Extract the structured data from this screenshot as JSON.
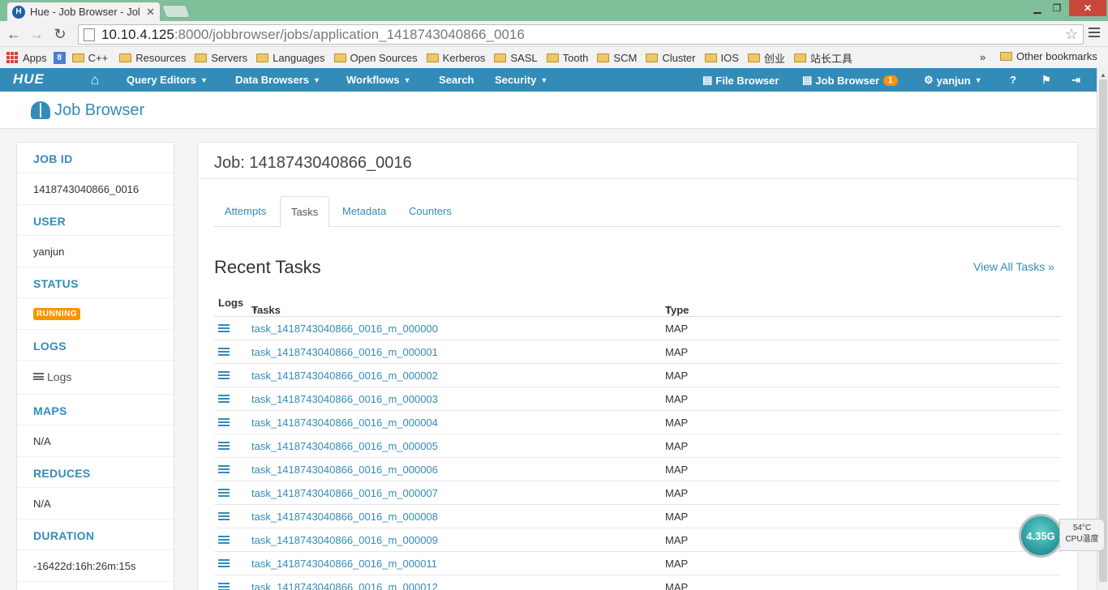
{
  "browser": {
    "tab_title": "Hue - Job Browser - Jol",
    "url_host": "10.10.4.125",
    "url_path": ":8000/jobbrowser/jobs/application_1418743040866_0016"
  },
  "bookmarks": {
    "apps": "Apps",
    "items": [
      "C++",
      "Resources",
      "Servers",
      "Languages",
      "Open Sources",
      "Kerberos",
      "SASL",
      "Tooth",
      "SCM",
      "Cluster",
      "IOS",
      "创业",
      "站长工具"
    ],
    "more": "»",
    "other": "Other bookmarks"
  },
  "nav": {
    "logo": "HUE",
    "query_editors": "Query Editors",
    "data_browsers": "Data Browsers",
    "workflows": "Workflows",
    "search": "Search",
    "security": "Security",
    "file_browser": "File Browser",
    "job_browser": "Job Browser",
    "job_browser_count": "1",
    "user": "yanjun",
    "brand_color": "#338bb8"
  },
  "page": {
    "title": "Job Browser"
  },
  "sidebar": {
    "job_id_label": "JOB ID",
    "job_id": "1418743040866_0016",
    "user_label": "USER",
    "user": "yanjun",
    "status_label": "STATUS",
    "status": "RUNNING",
    "logs_label": "LOGS",
    "logs": "Logs",
    "maps_label": "MAPS",
    "maps": "N/A",
    "reduces_label": "REDUCES",
    "reduces": "N/A",
    "duration_label": "DURATION",
    "duration": "-16422d:16h:26m:15s"
  },
  "main": {
    "job_title": "Job: 1418743040866_0016",
    "tabs": [
      "Attempts",
      "Tasks",
      "Metadata",
      "Counters"
    ],
    "active_tab": "Tasks",
    "section_title": "Recent Tasks",
    "view_all": "View All Tasks »",
    "columns": [
      "Logs",
      "Tasks",
      "Type"
    ],
    "rows": [
      {
        "task": "task_1418743040866_0016_m_000000",
        "type": "MAP"
      },
      {
        "task": "task_1418743040866_0016_m_000001",
        "type": "MAP"
      },
      {
        "task": "task_1418743040866_0016_m_000002",
        "type": "MAP"
      },
      {
        "task": "task_1418743040866_0016_m_000003",
        "type": "MAP"
      },
      {
        "task": "task_1418743040866_0016_m_000004",
        "type": "MAP"
      },
      {
        "task": "task_1418743040866_0016_m_000005",
        "type": "MAP"
      },
      {
        "task": "task_1418743040866_0016_m_000006",
        "type": "MAP"
      },
      {
        "task": "task_1418743040866_0016_m_000007",
        "type": "MAP"
      },
      {
        "task": "task_1418743040866_0016_m_000008",
        "type": "MAP"
      },
      {
        "task": "task_1418743040866_0016_m_000009",
        "type": "MAP"
      },
      {
        "task": "task_1418743040866_0016_m_000011",
        "type": "MAP"
      },
      {
        "task": "task_1418743040866_0016_m_000012",
        "type": "MAP"
      }
    ]
  },
  "cpu_widget": {
    "value": "4.35G",
    "temp": "54°C",
    "label": "CPU温度"
  }
}
